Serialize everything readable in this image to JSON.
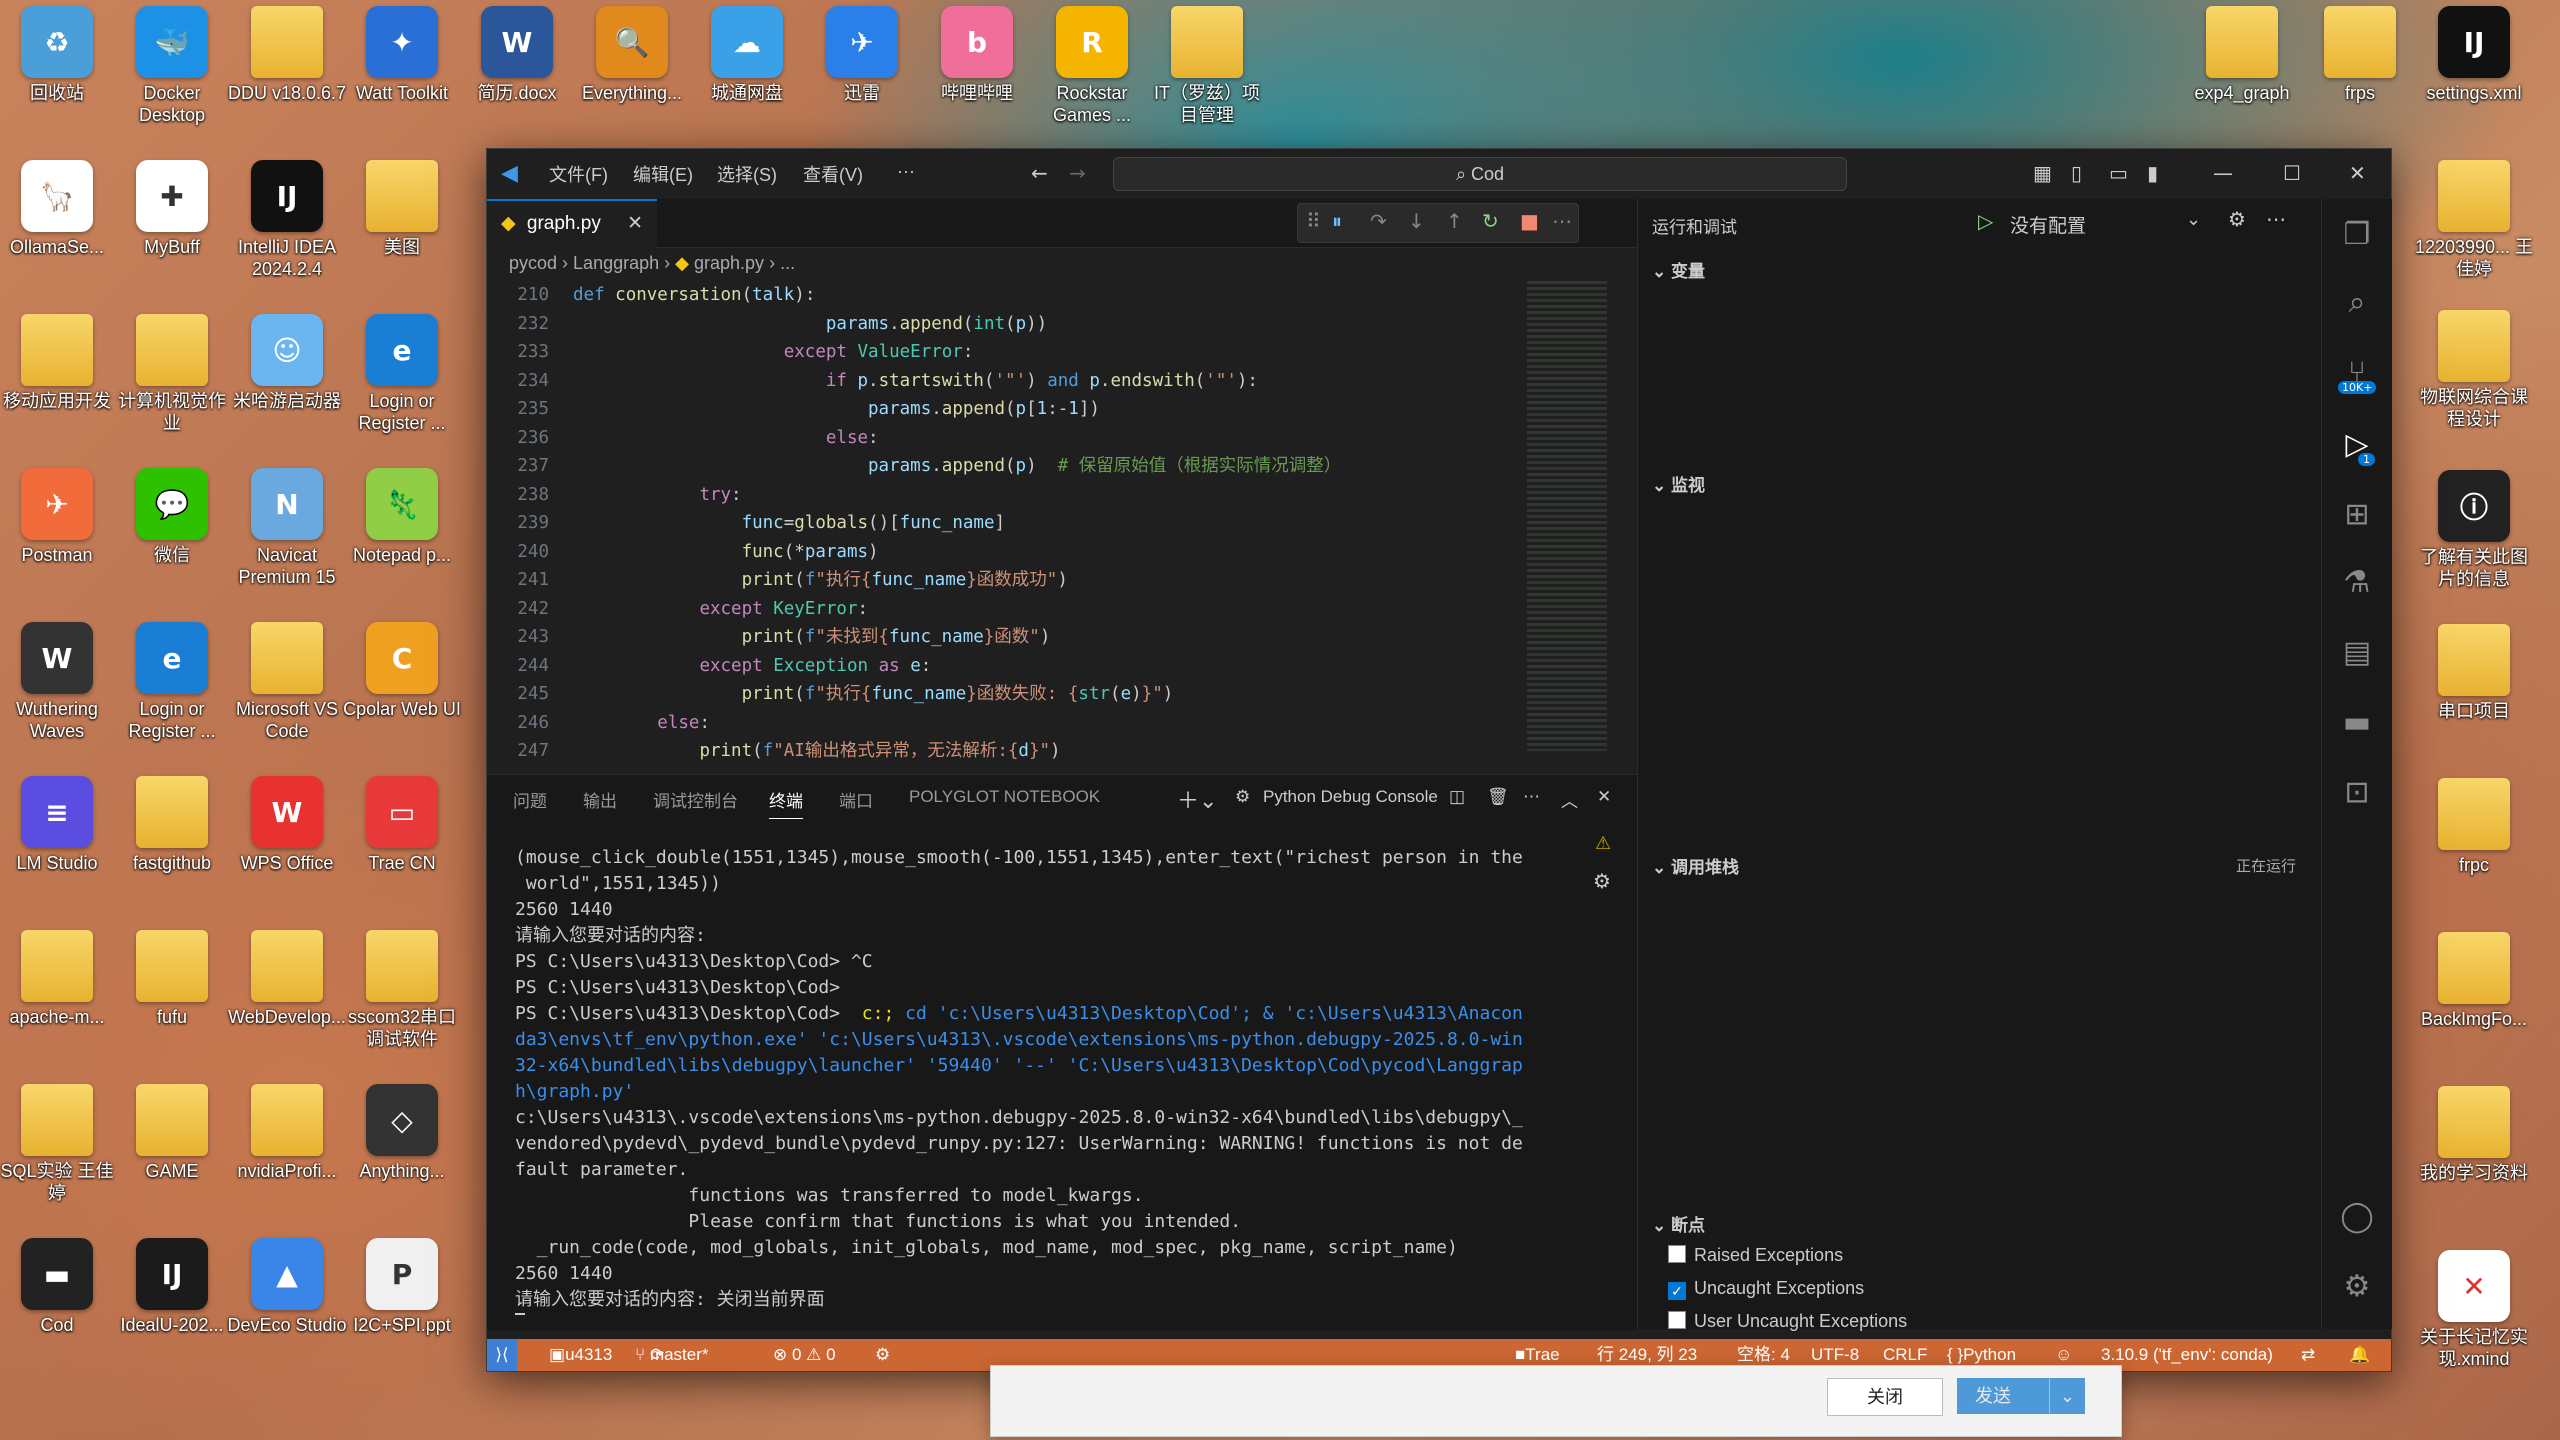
{
  "desktop_left": [
    {
      "label": "回收站",
      "color": "#4a9fd8",
      "glyph": "♻"
    },
    {
      "label": "Docker Desktop",
      "color": "#1d91e6",
      "glyph": "🐳"
    },
    {
      "label": "DDU v18.0.6.7",
      "color": "folder",
      "glyph": ""
    },
    {
      "label": "Watt Toolkit",
      "color": "#2a6fd6",
      "glyph": "✦"
    },
    {
      "label": "简历.docx",
      "color": "#2b579a",
      "glyph": "W"
    },
    {
      "label": "Everything...",
      "color": "#e08a1e",
      "glyph": "🔍"
    },
    {
      "label": "城通网盘",
      "color": "#3aa0e8",
      "glyph": "☁"
    },
    {
      "label": "迅雷",
      "color": "#2a7fe8",
      "glyph": "✈"
    },
    {
      "label": "哔哩哔哩",
      "color": "#f06f9a",
      "glyph": "b"
    },
    {
      "label": "Rockstar Games ...",
      "color": "#f5b400",
      "glyph": "R"
    },
    {
      "label": "IT（罗兹）项目管理",
      "color": "folder",
      "glyph": ""
    },
    {
      "label": "OllamaSe...",
      "color": "#ffffff",
      "glyph": "🦙"
    },
    {
      "label": "MyBuff",
      "color": "#ffffff",
      "glyph": "✚"
    },
    {
      "label": "IntelliJ IDEA 2024.2.4",
      "color": "#111111",
      "glyph": "IJ"
    },
    {
      "label": "美图",
      "color": "folder",
      "glyph": ""
    },
    {
      "label": "移动应用开发",
      "color": "folder",
      "glyph": ""
    },
    {
      "label": "计算机视觉作业",
      "color": "folder",
      "glyph": ""
    },
    {
      "label": "米哈游启动器",
      "color": "#6bb6f0",
      "glyph": "☺"
    },
    {
      "label": "Login or Register ...",
      "color": "#1a7fd4",
      "glyph": "e"
    },
    {
      "label": "Postman",
      "color": "#f26b3a",
      "glyph": "✈"
    },
    {
      "label": "微信",
      "color": "#2dc100",
      "glyph": "💬"
    },
    {
      "label": "Navicat Premium 15",
      "color": "#6aa8e0",
      "glyph": "N"
    },
    {
      "label": "Notepad p...",
      "color": "#8fce45",
      "glyph": "🦎"
    },
    {
      "label": "Wuthering Waves",
      "color": "#333333",
      "glyph": "W"
    },
    {
      "label": "Login or Register ...",
      "color": "#1a7fd4",
      "glyph": "e"
    },
    {
      "label": "Microsoft VS Code",
      "color": "folder",
      "glyph": ""
    },
    {
      "label": "Cpolar Web UI",
      "color": "#f0a020",
      "glyph": "C"
    },
    {
      "label": "LM Studio",
      "color": "#5a4de0",
      "glyph": "≡"
    },
    {
      "label": "fastgithub",
      "color": "folder",
      "glyph": ""
    },
    {
      "label": "WPS Office",
      "color": "#e8322f",
      "glyph": "W"
    },
    {
      "label": "Trae CN",
      "color": "#e83a3a",
      "glyph": "▭"
    },
    {
      "label": "apache-m...",
      "color": "folder",
      "glyph": ""
    },
    {
      "label": "fufu",
      "color": "folder",
      "glyph": ""
    },
    {
      "label": "WebDevelop...",
      "color": "folder",
      "glyph": ""
    },
    {
      "label": "sscom32串口调试软件",
      "color": "folder",
      "glyph": ""
    },
    {
      "label": "SQL实验 王佳婷",
      "color": "folder",
      "glyph": ""
    },
    {
      "label": "GAME",
      "color": "folder",
      "glyph": ""
    },
    {
      "label": "nvidiaProfi...",
      "color": "folder",
      "glyph": ""
    },
    {
      "label": "Anything...",
      "color": "#333333",
      "glyph": "◇"
    },
    {
      "label": "Cod",
      "color": "#222222",
      "glyph": "▬"
    },
    {
      "label": "IdealU-202...",
      "color": "#1b1b1b",
      "glyph": "IJ"
    },
    {
      "label": "DevEco Studio",
      "color": "#3a86e8",
      "glyph": "▲"
    },
    {
      "label": "I2C+SPI.ppt",
      "color": "#f0f0f0",
      "glyph": "P"
    }
  ],
  "desktop_right": [
    {
      "label": "exp4_graph",
      "color": "folder"
    },
    {
      "label": "frps",
      "color": "folder"
    },
    {
      "label": "settings.xml",
      "color": "#111111",
      "glyph": "IJ"
    },
    {
      "label": "12203990... 王佳婷",
      "color": "folder"
    },
    {
      "label": "物联网综合课程设计",
      "color": "folder"
    },
    {
      "label": "了解有关此图片的信息",
      "color": "#222222",
      "glyph": "ⓘ"
    },
    {
      "label": "串口项目",
      "color": "folder"
    },
    {
      "label": "frpc",
      "color": "folder"
    },
    {
      "label": "BackImgFo...",
      "color": "folder"
    },
    {
      "label": "我的学习资料",
      "color": "folder"
    },
    {
      "label": "关于长记忆实现.xmind",
      "color": "#ffffff",
      "glyph": "✕"
    }
  ],
  "window": {
    "menus": [
      "文件(F)",
      "编辑(E)",
      "选择(S)",
      "查看(V)",
      "···"
    ],
    "search": "Cod",
    "tab_name": "graph.py",
    "breadcrumb": [
      "pycod",
      "Langgraph",
      "graph.py",
      "..."
    ]
  },
  "code_lines": [
    {
      "n": "210",
      "html": "<span class='df'>def</span> <span class='fn'>conversation</span>(<span class='var'>talk</span>):"
    },
    {
      "n": "232",
      "html": "                        <span class='var'>params</span>.<span class='fn'>append</span>(<span class='bi'>int</span>(<span class='var'>p</span>))"
    },
    {
      "n": "233",
      "html": "                    <span class='kw'>except</span> <span class='bi'>ValueError</span>:"
    },
    {
      "n": "234",
      "html": "                        <span class='kw'>if</span> <span class='var'>p</span>.<span class='fn'>startswith</span>(<span class='str'>'\"'</span>) <span class='df'>and</span> <span class='var'>p</span>.<span class='fn'>endswith</span>(<span class='str'>'\"'</span>):"
    },
    {
      "n": "235",
      "html": "                            <span class='var'>params</span>.<span class='fn'>append</span>(<span class='var'>p</span>[<span class='var'>1</span>:-<span class='var'>1</span>])"
    },
    {
      "n": "236",
      "html": "                        <span class='kw'>else</span>:"
    },
    {
      "n": "237",
      "html": "                            <span class='var'>params</span>.<span class='fn'>append</span>(<span class='var'>p</span>)  <span class='cm'># 保留原始值（根据实际情况调整）</span>"
    },
    {
      "n": "238",
      "html": "            <span class='kw'>try</span>:"
    },
    {
      "n": "239",
      "html": "                <span class='var'>func</span>=<span class='fn'>globals</span>()[<span class='var'>func_name</span>]"
    },
    {
      "n": "240",
      "html": "                <span class='fn'>func</span>(*<span class='var'>params</span>)"
    },
    {
      "n": "241",
      "html": "                <span class='fn'>print</span>(<span class='df'>f</span><span class='str'>\"执行{</span><span class='var'>func_name</span><span class='str'>}函数成功\"</span>)"
    },
    {
      "n": "242",
      "html": "            <span class='kw'>except</span> <span class='bi'>KeyError</span>:"
    },
    {
      "n": "243",
      "html": "                <span class='fn'>print</span>(<span class='df'>f</span><span class='str'>\"未找到{</span><span class='var'>func_name</span><span class='str'>}函数\"</span>)"
    },
    {
      "n": "244",
      "html": "            <span class='kw'>except</span> <span class='bi'>Exception</span> <span class='kw'>as</span> <span class='var'>e</span>:"
    },
    {
      "n": "245",
      "html": "                <span class='fn'>print</span>(<span class='df'>f</span><span class='str'>\"执行{</span><span class='var'>func_name</span><span class='str'>}函数失败: {</span><span class='bi'>str</span>(<span class='var'>e</span>)<span class='str'>}\"</span>)"
    },
    {
      "n": "246",
      "html": "        <span class='kw'>else</span>:"
    },
    {
      "n": "247",
      "html": "            <span class='fn'>print</span>(<span class='df'>f</span><span class='str'>\"AI输出格式异常，无法解析:{</span><span class='var'>d</span><span class='str'>}\"</span>)"
    }
  ],
  "panel": {
    "tabs": [
      "问题",
      "输出",
      "调试控制台",
      "终端",
      "端口",
      "POLYGLOT NOTEBOOK"
    ],
    "active_tab": "终端",
    "console_label": "Python Debug Console"
  },
  "terminal_lines": [
    {
      "t": "(mouse_click_double(1551,1345),mouse_smooth(-100,1551,1345),enter_text(\"richest person in the"
    },
    {
      "t": " world\",1551,1345))"
    },
    {
      "t": "2560 1440"
    },
    {
      "t": "请输入您要对话的内容:"
    },
    {
      "t": "PS C:\\Users\\u4313\\Desktop\\Cod> ^C"
    },
    {
      "t": "PS C:\\Users\\u4313\\Desktop\\Cod>"
    },
    {
      "t": "PS C:\\Users\\u4313\\Desktop\\Cod>  c:; cd 'c:\\Users\\u4313\\Desktop\\Cod'; & 'c:\\Users\\u4313\\Anacon"
    },
    {
      "t": "da3\\envs\\tf_env\\python.exe' 'c:\\Users\\u4313\\.vscode\\extensions\\ms-python.debugpy-2025.8.0-win"
    },
    {
      "t": "32-x64\\bundled\\libs\\debugpy\\launcher' '59440' '--' 'C:\\Users\\u4313\\Desktop\\Cod\\pycod\\Langgrap"
    },
    {
      "t": "h\\graph.py'"
    },
    {
      "t": "c:\\Users\\u4313\\.vscode\\extensions\\ms-python.debugpy-2025.8.0-win32-x64\\bundled\\libs\\debugpy\\_"
    },
    {
      "t": "vendored\\pydevd\\_pydevd_bundle\\pydevd_runpy.py:127: UserWarning: WARNING! functions is not de"
    },
    {
      "t": "fault parameter."
    },
    {
      "t": "                functions was transferred to model_kwargs."
    },
    {
      "t": "                Please confirm that functions is what you intended."
    },
    {
      "t": "  _run_code(code, mod_globals, init_globals, mod_name, mod_spec, pkg_name, script_name)"
    },
    {
      "t": "2560 1440"
    },
    {
      "t": "请输入您要对话的内容: 关闭当前界面"
    }
  ],
  "debug": {
    "title": "运行和调试",
    "config": "没有配置",
    "sections": {
      "variables": "变量",
      "watch": "监视",
      "callstack": "调用堆栈",
      "callstack_status": "正在运行",
      "breakpoints": "断点"
    },
    "breakpoints": [
      {
        "label": "Raised Exceptions",
        "checked": false
      },
      {
        "label": "Uncaught Exceptions",
        "checked": true
      },
      {
        "label": "User Uncaught Exceptions",
        "checked": false
      }
    ]
  },
  "status": {
    "user": "u4313",
    "branch": "master*",
    "problems": "⊗ 0 ⚠ 0",
    "trae": "Trae",
    "position": "行 249, 列 23",
    "spaces": "空格: 4",
    "encoding": "UTF-8",
    "eol": "CRLF",
    "language": "Python",
    "interpreter": "3.10.9 ('tf_env': conda)",
    "activity_badge": "10K+",
    "debug_badge": "1"
  },
  "dialog": {
    "close": "关闭",
    "send": "发送"
  }
}
